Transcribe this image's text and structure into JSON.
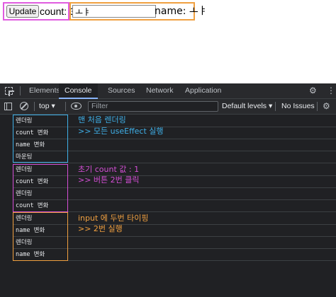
{
  "app": {
    "update_button": "Update",
    "count_text": "count: 3",
    "name_input_value": "ㅗㅑ",
    "name_text": "name: ㅗㅑ"
  },
  "devtools": {
    "tabs": [
      "Elements",
      "Console",
      "Sources",
      "Network",
      "Application"
    ],
    "active_tab": "Console",
    "toolbar": {
      "context": "top ▾",
      "filter_placeholder": "Filter",
      "levels": "Default levels ▾",
      "issues": "No Issues"
    },
    "logs": [
      {
        "text": "렌더링"
      },
      {
        "text": "count 변화"
      },
      {
        "text": "name 변화"
      },
      {
        "text": "마운팅"
      },
      {
        "text": "렌더링"
      },
      {
        "text": "count 변화"
      },
      {
        "text": "렌더링"
      },
      {
        "text": "count 변화"
      },
      {
        "text": "렌더링"
      },
      {
        "text": "name 변화"
      },
      {
        "text": "렌더링"
      },
      {
        "text": "name 변화"
      }
    ],
    "annotations": {
      "group1_line1": "맨 처음 렌더링",
      "group1_line2": ">> 모든 useEffect 실행",
      "group2_line1": "초기 count 값 : 1",
      "group2_line2": ">> 버튼 2번 클릭",
      "group3_line1": "input 에 두번 타이핑",
      "group3_line2": ">> 2번 실행"
    },
    "colors": {
      "group1": "#3fb0e8",
      "group2": "#d54fd6",
      "group3": "#f0a040"
    }
  }
}
